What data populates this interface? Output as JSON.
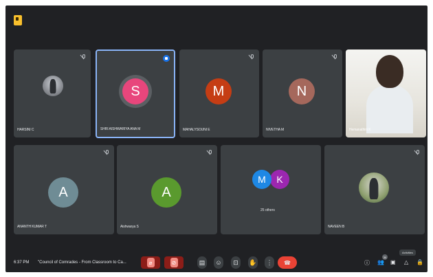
{
  "app": {
    "logo_icon": "meet-logo-icon"
  },
  "participants": [
    {
      "name": "HARSINI C",
      "type": "photo",
      "muted": true
    },
    {
      "name": "SHRI AISHWARIYA ANA M",
      "type": "avatar",
      "initial": "S",
      "color": "#e8467c",
      "muted": false,
      "speaking": true
    },
    {
      "name": "MAHALYSOUNI E",
      "type": "avatar",
      "initial": "M",
      "color": "#c53d14",
      "muted": true
    },
    {
      "name": "NIVETHA M",
      "type": "avatar",
      "initial": "N",
      "color": "#a5685c",
      "muted": true
    },
    {
      "name": "Hemanathini K",
      "type": "camera",
      "muted": false
    },
    {
      "name": "ANANTH KUMAR T",
      "type": "avatar",
      "initial": "A",
      "color": "#6f8c95",
      "muted": true
    },
    {
      "name": "Aishwarya S",
      "type": "avatar",
      "initial": "A",
      "color": "#5a9a2e",
      "muted": true
    },
    {
      "name": "25 others",
      "type": "group",
      "initials": [
        "M",
        "K"
      ],
      "colors": [
        "#1e88e5",
        "#9c27b0"
      ]
    },
    {
      "name": "NAVEEN B",
      "type": "photo",
      "muted": true
    }
  ],
  "bottom_bar": {
    "time": "6:37 PM",
    "meeting_title": "\"Council of Comrades - From Classroom to Ca...",
    "controls": [
      "mic-off-icon",
      "camera-off-icon",
      "captions-icon",
      "emoji-icon",
      "present-icon",
      "raise-hand-icon",
      "more-options-icon",
      "end-call-icon"
    ],
    "right_icons": [
      "info-icon",
      "people-icon",
      "chat-icon",
      "activities-icon",
      "host-controls-icon"
    ],
    "participant_count": "30",
    "tooltip": "Activities"
  }
}
